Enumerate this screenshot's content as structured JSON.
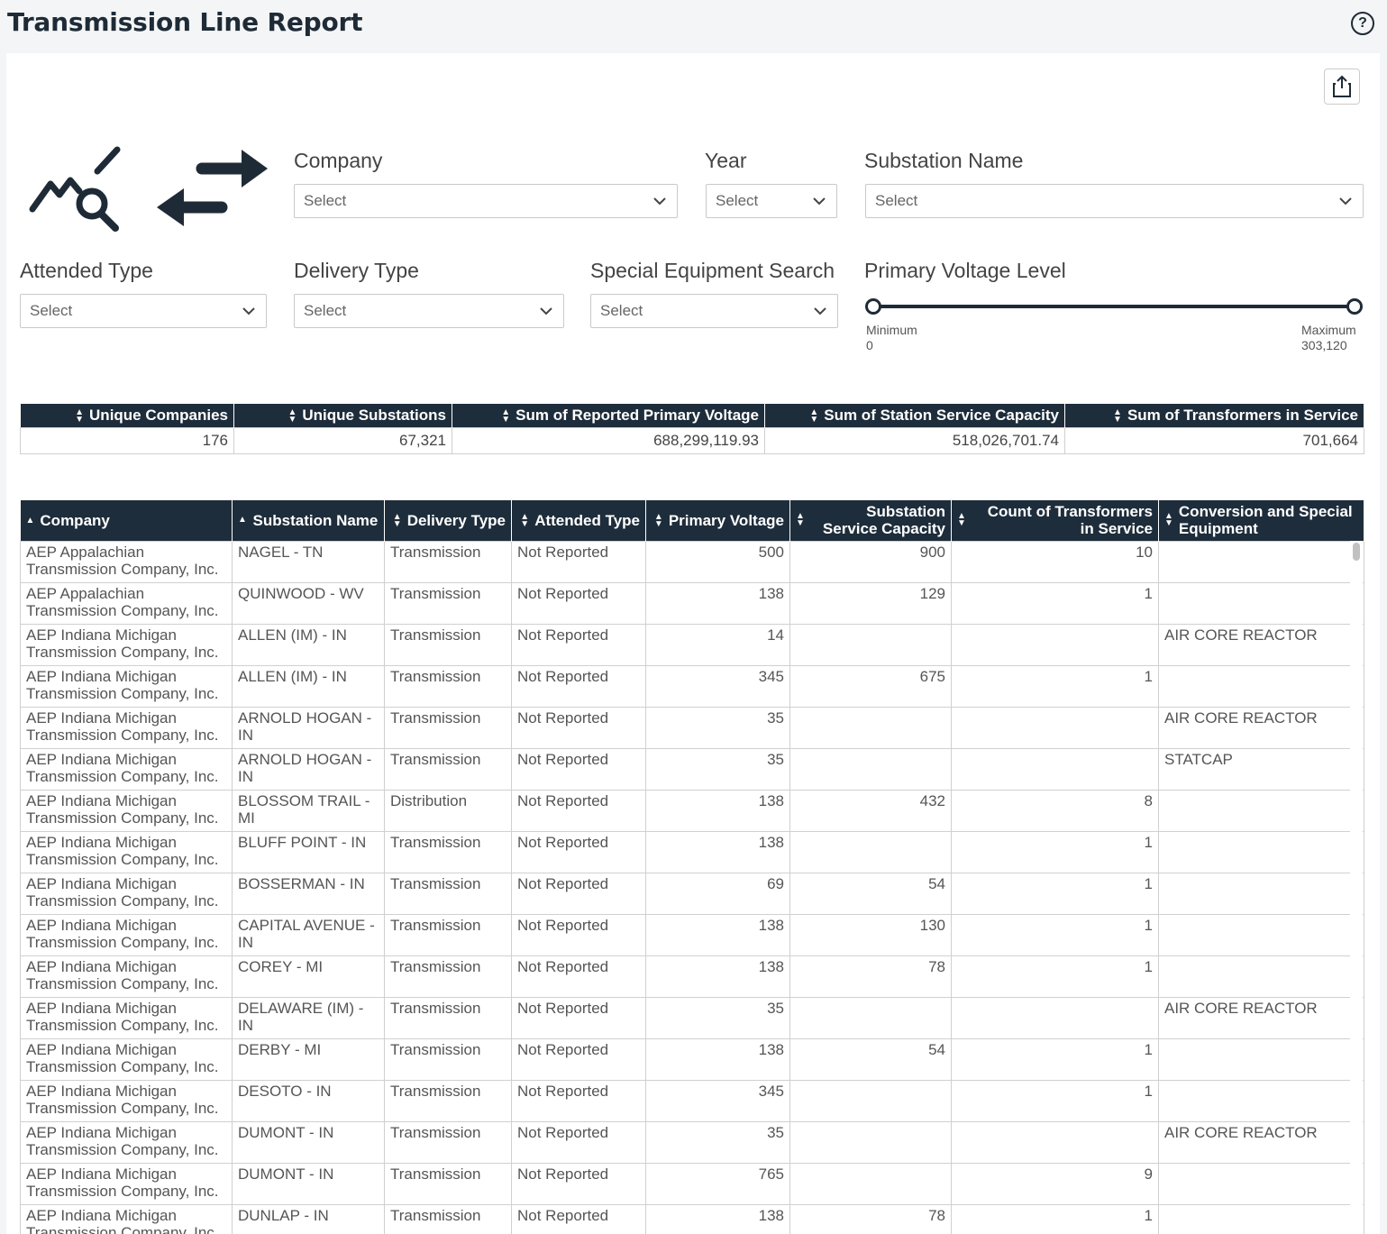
{
  "header": {
    "title": "Transmission Line Report",
    "help_icon": "question-circle-icon"
  },
  "toolbar": {
    "export_icon": "share-export-icon"
  },
  "filters": {
    "company": {
      "label": "Company",
      "placeholder": "Select"
    },
    "year": {
      "label": "Year",
      "placeholder": "Select"
    },
    "substation_name": {
      "label": "Substation Name",
      "placeholder": "Select"
    },
    "attended_type": {
      "label": "Attended Type",
      "placeholder": "Select"
    },
    "delivery_type": {
      "label": "Delivery Type",
      "placeholder": "Select"
    },
    "special_equipment": {
      "label": "Special Equipment Search",
      "placeholder": "Select"
    },
    "primary_voltage": {
      "label": "Primary Voltage Level",
      "min_label": "Minimum",
      "min_value": "0",
      "max_label": "Maximum",
      "max_value": "303,120"
    }
  },
  "summary": {
    "headers": [
      "Unique Companies",
      "Unique Substations",
      "Sum of Reported Primary Voltage",
      "Sum of Station Service Capacity",
      "Sum of Transformers in Service"
    ],
    "values": [
      "176",
      "67,321",
      "688,299,119.93",
      "518,026,701.74",
      "701,664"
    ]
  },
  "table": {
    "headers": [
      "Company",
      "Substation Name",
      "Delivery Type",
      "Attended Type",
      "Primary Voltage",
      "Substation Service Capacity",
      "Count of Transformers in Service",
      "Conversion and Special Equipment"
    ],
    "rows": [
      [
        "AEP Appalachian Transmission Company, Inc.",
        "NAGEL - TN",
        "Transmission",
        "Not Reported",
        "500",
        "900",
        "10",
        ""
      ],
      [
        "AEP Appalachian Transmission Company, Inc.",
        "QUINWOOD - WV",
        "Transmission",
        "Not Reported",
        "138",
        "129",
        "1",
        ""
      ],
      [
        "AEP Indiana Michigan Transmission Company, Inc.",
        "ALLEN (IM) - IN",
        "Transmission",
        "Not Reported",
        "14",
        "",
        "",
        "AIR CORE REACTOR"
      ],
      [
        "AEP Indiana Michigan Transmission Company, Inc.",
        "ALLEN (IM) - IN",
        "Transmission",
        "Not Reported",
        "345",
        "675",
        "1",
        ""
      ],
      [
        "AEP Indiana Michigan Transmission Company, Inc.",
        "ARNOLD HOGAN - IN",
        "Transmission",
        "Not Reported",
        "35",
        "",
        "",
        "AIR CORE REACTOR"
      ],
      [
        "AEP Indiana Michigan Transmission Company, Inc.",
        "ARNOLD HOGAN - IN",
        "Transmission",
        "Not Reported",
        "35",
        "",
        "",
        "STATCAP"
      ],
      [
        "AEP Indiana Michigan Transmission Company, Inc.",
        "BLOSSOM TRAIL - MI",
        "Distribution",
        "Not Reported",
        "138",
        "432",
        "8",
        ""
      ],
      [
        "AEP Indiana Michigan Transmission Company, Inc.",
        "BLUFF POINT - IN",
        "Transmission",
        "Not Reported",
        "138",
        "",
        "1",
        ""
      ],
      [
        "AEP Indiana Michigan Transmission Company, Inc.",
        "BOSSERMAN - IN",
        "Transmission",
        "Not Reported",
        "69",
        "54",
        "1",
        ""
      ],
      [
        "AEP Indiana Michigan Transmission Company, Inc.",
        "CAPITAL AVENUE - IN",
        "Transmission",
        "Not Reported",
        "138",
        "130",
        "1",
        ""
      ],
      [
        "AEP Indiana Michigan Transmission Company, Inc.",
        "COREY - MI",
        "Transmission",
        "Not Reported",
        "138",
        "78",
        "1",
        ""
      ],
      [
        "AEP Indiana Michigan Transmission Company, Inc.",
        "DELAWARE (IM) - IN",
        "Transmission",
        "Not Reported",
        "35",
        "",
        "",
        "AIR CORE REACTOR"
      ],
      [
        "AEP Indiana Michigan Transmission Company, Inc.",
        "DERBY - MI",
        "Transmission",
        "Not Reported",
        "138",
        "54",
        "1",
        ""
      ],
      [
        "AEP Indiana Michigan Transmission Company, Inc.",
        "DESOTO - IN",
        "Transmission",
        "Not Reported",
        "345",
        "",
        "1",
        ""
      ],
      [
        "AEP Indiana Michigan Transmission Company, Inc.",
        "DUMONT - IN",
        "Transmission",
        "Not Reported",
        "35",
        "",
        "",
        "AIR CORE REACTOR"
      ],
      [
        "AEP Indiana Michigan Transmission Company, Inc.",
        "DUMONT - IN",
        "Transmission",
        "Not Reported",
        "765",
        "",
        "9",
        ""
      ],
      [
        "AEP Indiana Michigan Transmission Company, Inc.",
        "DUNLAP - IN",
        "Transmission",
        "Not Reported",
        "138",
        "78",
        "1",
        ""
      ]
    ]
  }
}
